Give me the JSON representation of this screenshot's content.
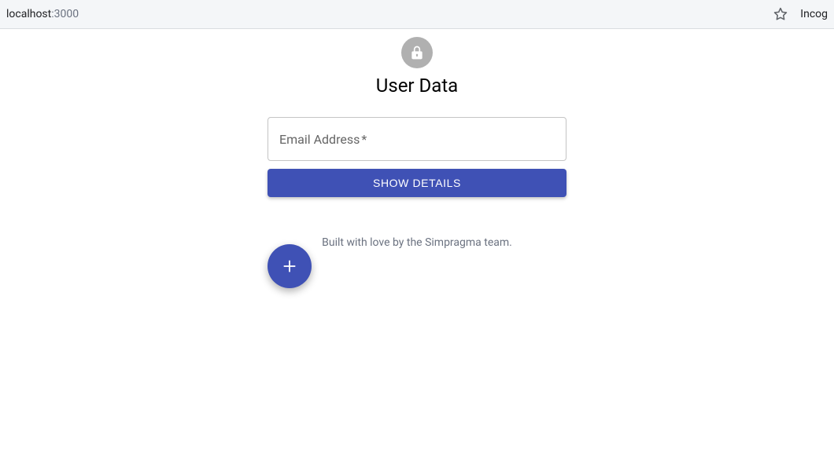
{
  "address_bar": {
    "host": "localhost",
    "port": ":3000",
    "right_label": "Incog"
  },
  "header": {
    "title": "User Data"
  },
  "form": {
    "email_label": "Email Address",
    "email_required_mark": "*",
    "email_value": "",
    "submit_label": "SHOW DETAILS"
  },
  "footer": {
    "text": "Built with love by the Simpragma team."
  },
  "fab": {
    "aria_label": "Add"
  },
  "colors": {
    "primary": "#3f51b5",
    "muted_text": "#6b7280",
    "badge_bg": "#b0b0b0"
  }
}
